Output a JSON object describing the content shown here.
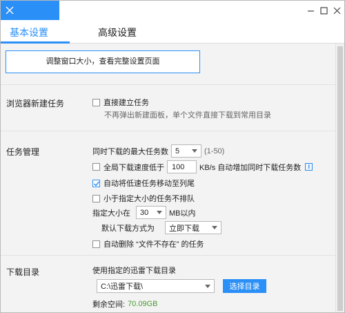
{
  "tabs": [
    {
      "label": "基本设置",
      "active": true
    },
    {
      "label": "高级设置",
      "active": false
    }
  ],
  "resize_banner": "调整窗口大小，查看完整设置页面",
  "browser_task": {
    "title": "浏览器新建任务",
    "direct_create": {
      "label": "直接建立任务",
      "checked": false
    },
    "hint": "不再弹出新建面板，单个文件直接下载到常用目录"
  },
  "task_manage": {
    "title": "任务管理",
    "max_tasks_label": "同时下载的最大任务数",
    "max_tasks_value": "5",
    "max_tasks_range": "(1-50)",
    "speed_limit": {
      "label": "全局下载速度低于",
      "checked": false,
      "value": "100",
      "suffix": "KB/s 自动增加同时下载任务数"
    },
    "move_slow": {
      "label": "自动将低速任务移动至列尾",
      "checked": true
    },
    "small_no_queue": {
      "label": "小于指定大小的任务不排队",
      "checked": false
    },
    "size_label": "指定大小在",
    "size_value": "30",
    "size_suffix": "MB以内",
    "default_mode_label": "默认下载方式为",
    "default_mode_value": "立即下载",
    "auto_delete": {
      "label": "自动删除 “文件不存在” 的任务",
      "checked": false
    }
  },
  "download_dir": {
    "title": "下载目录",
    "use_label": "使用指定的迅雷下载目录",
    "path": "C:\\迅雷下载\\",
    "choose_button": "选择目录",
    "free_label": "剩余空间:",
    "free_value": "70.09GB"
  },
  "colors": {
    "accent": "#2a8ff7",
    "free_space": "#4a9a2e"
  }
}
